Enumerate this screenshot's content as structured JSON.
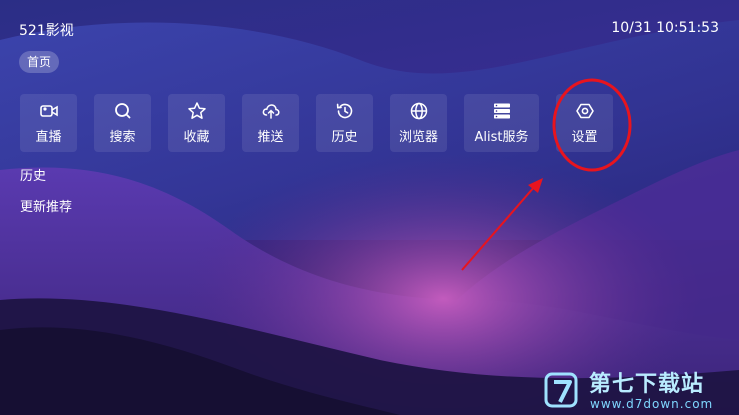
{
  "header": {
    "app_title": "521影视",
    "datetime": "10/31 10:51:53"
  },
  "tabs": [
    {
      "label": "首页",
      "selected": true
    }
  ],
  "actions": [
    {
      "label": "直播",
      "icon": "video-camera-icon"
    },
    {
      "label": "搜索",
      "icon": "search-icon"
    },
    {
      "label": "收藏",
      "icon": "star-icon"
    },
    {
      "label": "推送",
      "icon": "cloud-upload-icon"
    },
    {
      "label": "历史",
      "icon": "history-icon"
    },
    {
      "label": "浏览器",
      "icon": "globe-icon"
    },
    {
      "label": "Alist服务",
      "icon": "server-icon"
    },
    {
      "label": "设置",
      "icon": "gear-icon"
    }
  ],
  "sections": [
    {
      "label": "历史"
    },
    {
      "label": "更新推荐"
    }
  ],
  "annotation": {
    "color": "#e8141e",
    "highlighted": "设置"
  },
  "watermark": {
    "title": "第七下载站",
    "url": "www.d7down.com"
  }
}
